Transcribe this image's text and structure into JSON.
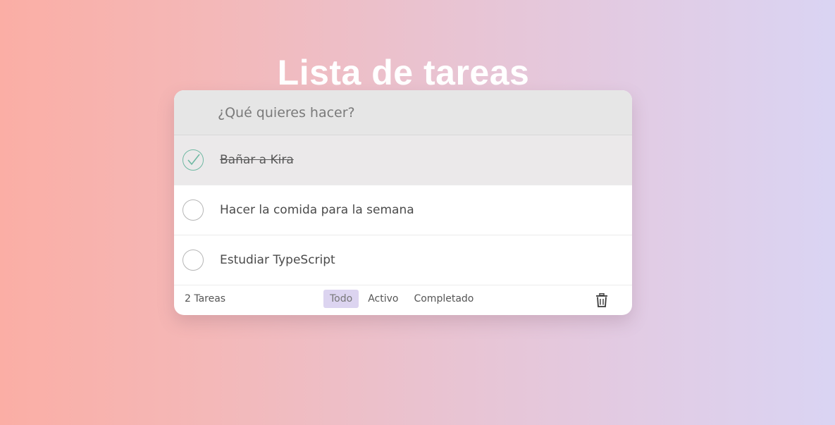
{
  "header": {
    "title": "Lista de tareas"
  },
  "new_todo": {
    "placeholder": "¿Qué quieres hacer?"
  },
  "todos": [
    {
      "label": "Bañar a Kira",
      "completed": true
    },
    {
      "label": "Hacer la comida para la semana",
      "completed": false
    },
    {
      "label": "Estudiar TypeScript",
      "completed": false
    }
  ],
  "footer": {
    "count_label": "2 Tareas",
    "filters": [
      {
        "label": "Todo",
        "selected": true
      },
      {
        "label": "Activo",
        "selected": false
      },
      {
        "label": "Completado",
        "selected": false
      }
    ],
    "clear_icon": "trash-icon"
  },
  "colors": {
    "gradient_left": "#fbaea5",
    "gradient_right": "#dad4f3",
    "check_color": "#6fb8a2",
    "selected_filter_bg": "#dcd4f0"
  }
}
